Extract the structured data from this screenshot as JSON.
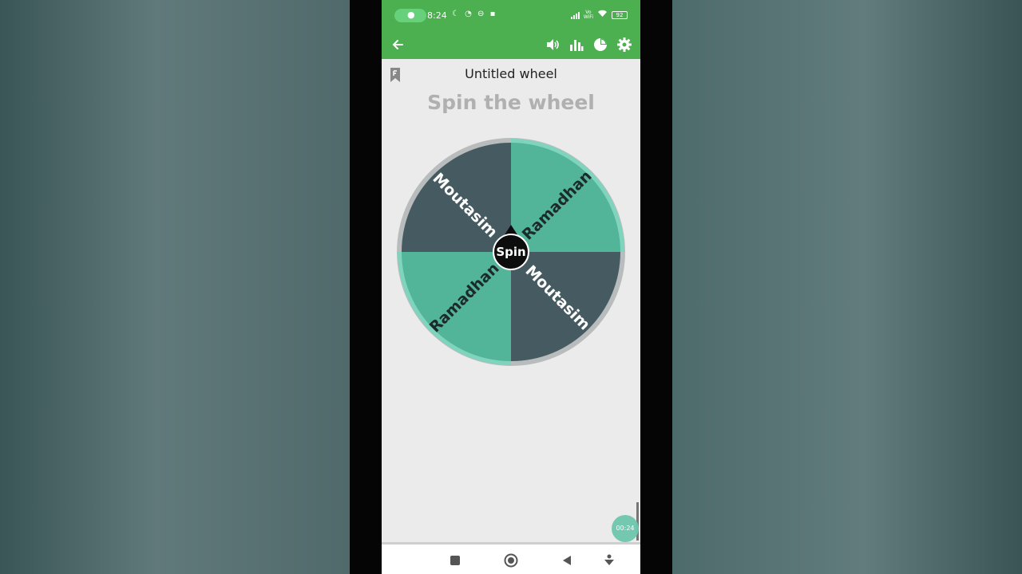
{
  "status_bar": {
    "time": "8:24",
    "vo_label": "Vo",
    "wifi_label": "WiFi",
    "battery": "92"
  },
  "toolbar": {
    "icons": [
      "back-arrow-icon",
      "volume-icon",
      "bar-chart-icon",
      "pie-chart-icon",
      "gear-icon"
    ]
  },
  "wheel": {
    "title": "Untitled wheel",
    "subtitle": "Spin the wheel",
    "spin_label": "Spin",
    "segments": [
      {
        "label": "Ramadhan",
        "color": "#52b59a"
      },
      {
        "label": "Moutasim",
        "color": "#465b61"
      },
      {
        "label": "Ramadhan",
        "color": "#52b59a"
      },
      {
        "label": "Moutasim",
        "color": "#465b61"
      }
    ],
    "rim_color": "#7fd4bd"
  },
  "recording": {
    "timer": "00:24"
  },
  "colors": {
    "accent": "#4caf50",
    "background": "#ebebeb"
  }
}
